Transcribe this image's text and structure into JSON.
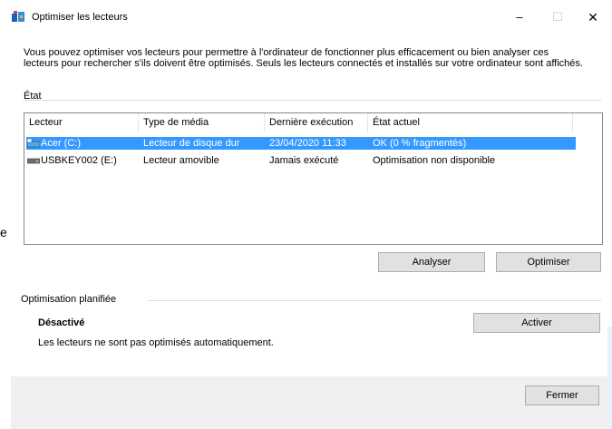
{
  "window": {
    "title": "Optimiser les lecteurs",
    "min_glyph": "–",
    "max_glyph": "☐",
    "close_glyph": "✕"
  },
  "description": "Vous pouvez optimiser vos lecteurs pour permettre à l'ordinateur de fonctionner plus efficacement ou bien analyser ces lecteurs pour rechercher s'ils doivent être optimisés. Seuls les lecteurs connectés et installés sur votre ordinateur sont affichés.",
  "status_section": {
    "label": "État"
  },
  "drives_table": {
    "columns": [
      "Lecteur",
      "Type de média",
      "Dernière exécution",
      "État actuel"
    ],
    "rows": [
      {
        "drive": "Acer (C:)",
        "media_type": "Lecteur de disque dur",
        "last_run": "23/04/2020 11:33",
        "status": "OK (0 % fragmentés)",
        "selected": true,
        "icon": "hard-drive-icon"
      },
      {
        "drive": "USBKEY002 (E:)",
        "media_type": "Lecteur amovible",
        "last_run": "Jamais exécuté",
        "status": "Optimisation non disponible",
        "selected": false,
        "icon": "usb-drive-icon"
      }
    ]
  },
  "buttons": {
    "analyze": "Analyser",
    "optimize": "Optimiser",
    "activate": "Activer",
    "close": "Fermer"
  },
  "scheduled": {
    "label": "Optimisation planifiée",
    "state": "Désactivé",
    "note": "Les lecteurs ne sont pas optimisés automatiquement."
  },
  "partial_glyph_left": "e",
  "colors": {
    "selection": "#3399ff",
    "footer": "#f0f0f0",
    "button_face": "#e1e1e1"
  }
}
